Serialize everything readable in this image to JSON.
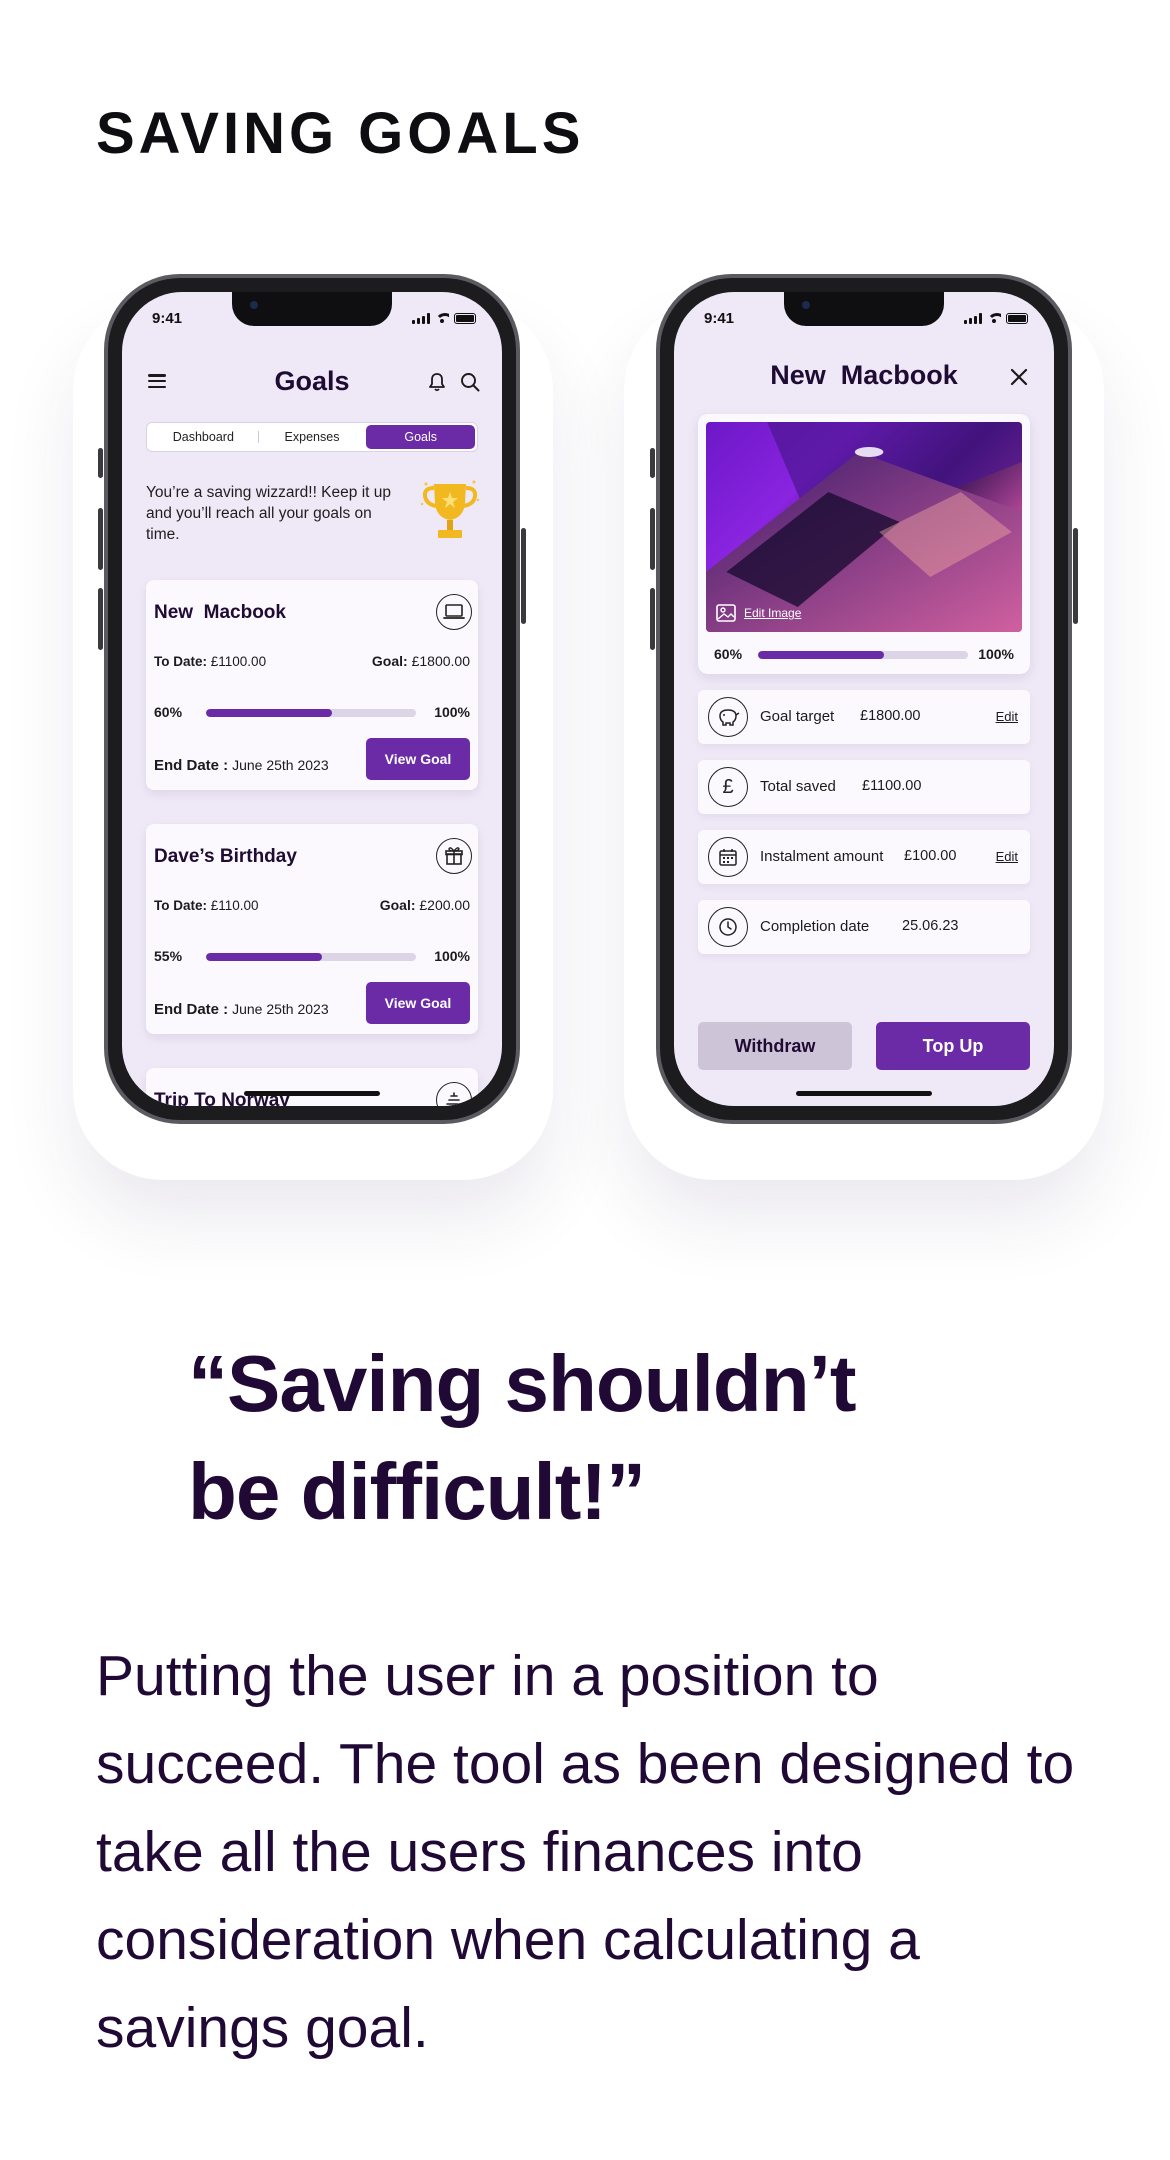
{
  "page": {
    "section_title": "SAVING GOALS",
    "quote": "“Saving shouldn’t be difficult!”",
    "paragraph": "Putting the user in a position to succeed. The tool as been designed to take all the users finances into consideration when calculating a savings goal."
  },
  "colors": {
    "accent": "#6b2ba6",
    "screen_bg": "#efe9f7",
    "text_dark": "#200a35",
    "withdraw_bg": "#cdc4d8"
  },
  "phone1": {
    "status_time": "9:41",
    "title": "Goals",
    "icons": [
      "menu-icon",
      "bell-icon",
      "search-icon"
    ],
    "tabs": [
      {
        "label": "Dashboard",
        "active": false
      },
      {
        "label": "Expenses",
        "active": false
      },
      {
        "label": "Goals",
        "active": true
      }
    ],
    "encouragement": "You’re a saving wizzard!! Keep it up and you’ll reach all your goals on time.",
    "goals": [
      {
        "name": "New  Macbook",
        "icon": "laptop-icon",
        "to_date_label": "To Date:",
        "to_date_value": "£1100.00",
        "goal_label": "Goal:",
        "goal_value": "£1800.00",
        "progress_label": "60%",
        "progress": 0.6,
        "max_label": "100%",
        "end_date_label": "End Date :",
        "end_date_value": "June 25th 2023",
        "button": "View Goal"
      },
      {
        "name": "Dave’s Birthday",
        "icon": "gift-icon",
        "to_date_label": "To Date:",
        "to_date_value": "£110.00",
        "goal_label": "Goal:",
        "goal_value": "£200.00",
        "progress_label": "55%",
        "progress": 0.55,
        "max_label": "100%",
        "end_date_label": "End Date :",
        "end_date_value": "June 25th 2023",
        "button": "View Goal"
      },
      {
        "name": "Trip To Norway",
        "icon": "plane-icon"
      }
    ]
  },
  "phone2": {
    "status_time": "9:41",
    "title": "New  Macbook",
    "close_icon": "close-icon",
    "edit_image": "Edit Image",
    "progress_label": "60%",
    "progress": 0.6,
    "max_label": "100%",
    "rows": [
      {
        "icon": "piggy-bank-icon",
        "label": "Goal target",
        "value": "£1800.00",
        "edit": "Edit"
      },
      {
        "icon": "pound-icon",
        "label": "Total saved",
        "value": "£1100.00",
        "edit": ""
      },
      {
        "icon": "calendar-icon",
        "label": "Instalment amount",
        "value": "£100.00",
        "edit": "Edit"
      },
      {
        "icon": "clock-icon",
        "label": "Completion date",
        "value": "25.06.23",
        "edit": ""
      }
    ],
    "withdraw": "Withdraw",
    "top_up": "Top Up"
  }
}
